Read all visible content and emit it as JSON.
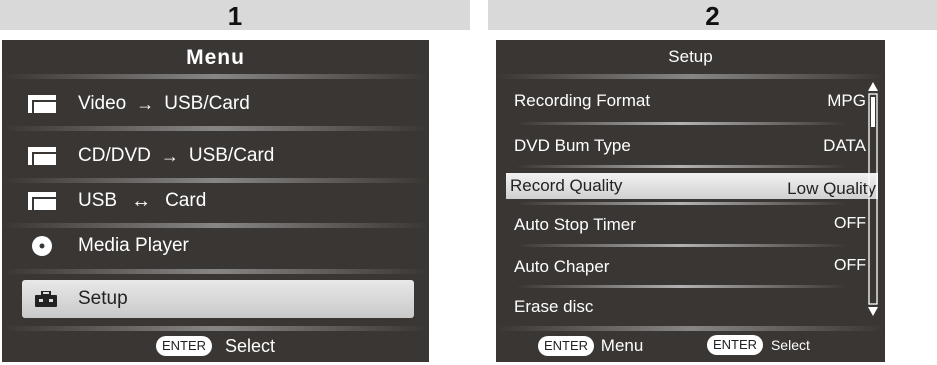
{
  "steps": [
    "1",
    "2"
  ],
  "menu": {
    "title": "Menu",
    "items": [
      {
        "icon": "tv-icon",
        "parts": [
          "Video",
          "USB/Card"
        ],
        "arrow": "→"
      },
      {
        "icon": "tv-icon",
        "parts": [
          "CD/DVD",
          "USB/Card"
        ],
        "arrow": "→"
      },
      {
        "icon": "tv-icon",
        "parts": [
          "USB",
          "Card"
        ],
        "arrow": "↔"
      },
      {
        "icon": "disc-icon",
        "label": "Media Player"
      },
      {
        "icon": "toolbox-icon",
        "label": "Setup",
        "selected": true
      }
    ],
    "footer": {
      "key": "ENTER",
      "action": "Select"
    }
  },
  "setup": {
    "title": "Setup",
    "items": [
      {
        "label": "Recording Format",
        "value": "MPG"
      },
      {
        "label": "DVD Bum Type",
        "value": "DATA"
      },
      {
        "label": "Record Quality",
        "value": "Low Quality",
        "selected": true
      },
      {
        "label": "Auto Stop Timer",
        "value": "OFF"
      },
      {
        "label": "Auto Chaper",
        "value": "OFF"
      },
      {
        "label": "Erase disc",
        "value": ""
      }
    ],
    "footer": [
      {
        "key": "ENTER",
        "action": "Menu"
      },
      {
        "key": "ENTER",
        "action": "Select"
      }
    ]
  },
  "colors": {
    "panel_bg": "#3a3633",
    "highlight": "#d9d9d9",
    "step_bar": "#d9d9d9"
  }
}
